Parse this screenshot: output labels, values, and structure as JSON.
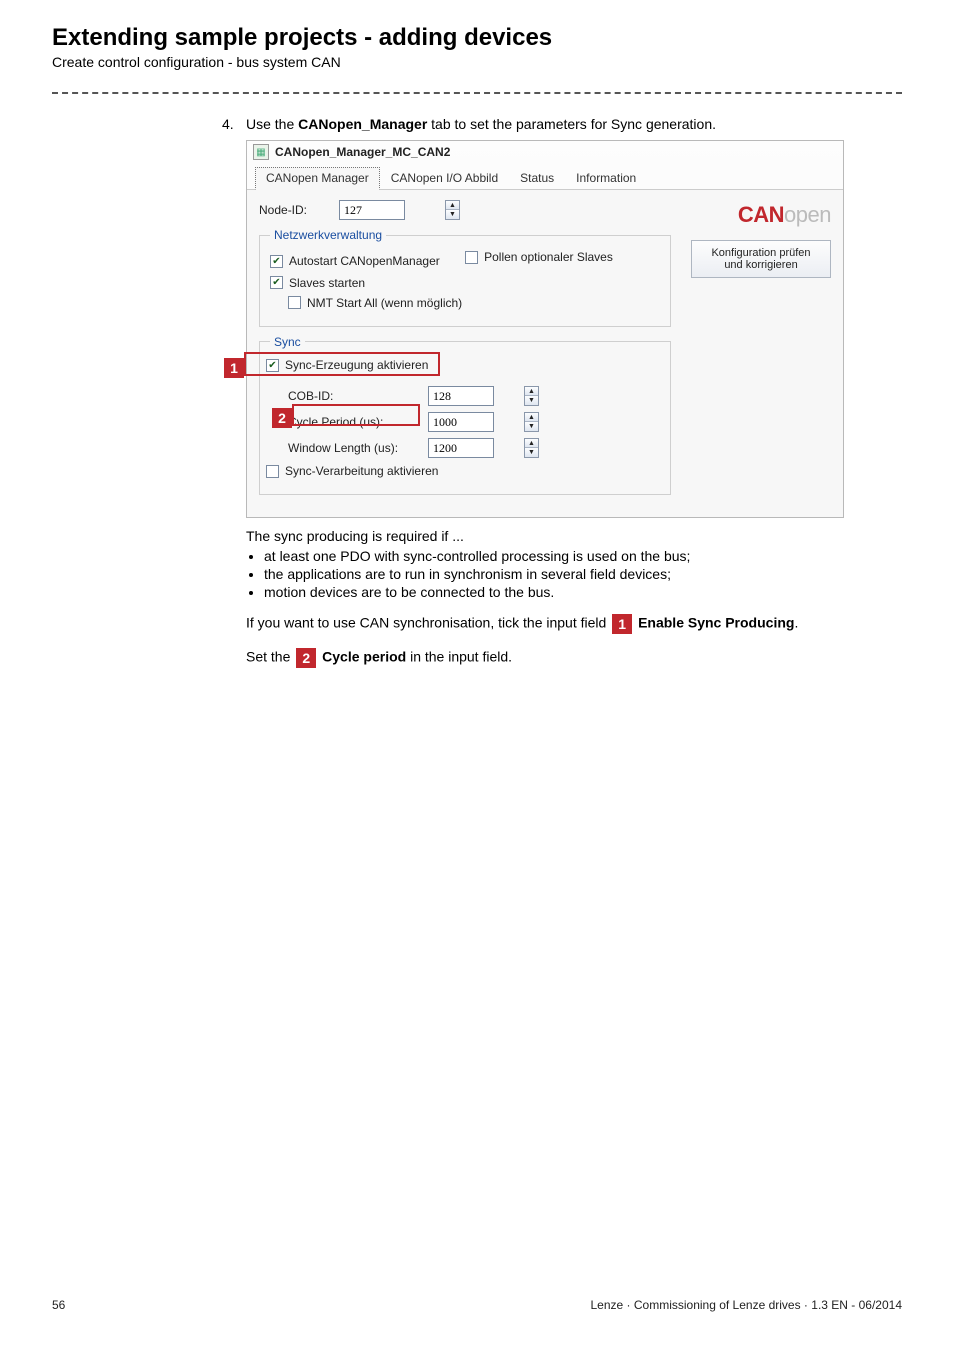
{
  "header": {
    "title": "Extending sample projects - adding devices",
    "subtitle": "Create control configuration - bus system CAN"
  },
  "step": {
    "number": "4.",
    "text_before": "Use the ",
    "bold": "CANopen_Manager",
    "text_after": " tab to set the parameters for Sync generation."
  },
  "shot": {
    "window_title": "CANopen_Manager_MC_CAN2",
    "tabs": [
      "CANopen Manager",
      "CANopen I/O Abbild",
      "Status",
      "Information"
    ],
    "node_id_label": "Node-ID:",
    "node_id_value": "127",
    "net_legend": "Netzwerkverwaltung",
    "autostart": "Autostart CANopenManager",
    "poll_optional": "Pollen optionaler Slaves",
    "slaves_start": "Slaves starten",
    "nmt_start": "NMT Start All (wenn möglich)",
    "sync_legend": "Sync",
    "sync_enable": "Sync-Erzeugung aktivieren",
    "cob_id_label": "COB-ID:",
    "cob_id_value": "128",
    "cycle_label": "Cycle Period (us):",
    "cycle_value": "1000",
    "winlen_label": "Window Length (us):",
    "winlen_value": "1200",
    "sync_proc": "Sync-Verarbeitung aktivieren",
    "logo_bold": "CAN",
    "logo_thin": "open",
    "cfg_btn_l1": "Konfiguration prüfen",
    "cfg_btn_l2": "und korrigieren"
  },
  "callouts": {
    "one": "1",
    "two": "2"
  },
  "body": {
    "intro": "The sync producing is required if ...",
    "bullets": [
      "at least one PDO with sync-controlled processing is used on the bus;",
      "the applications are to run in synchronism in several field devices;",
      "motion devices are to be connected to the bus."
    ],
    "line1_a": "If you want to use CAN synchronisation, tick the input field ",
    "line1_b": " Enable Sync Producing",
    "line1_c": ".",
    "line2_a": "Set the ",
    "line2_b": " Cycle period",
    "line2_c": " in the input field."
  },
  "footer": {
    "page": "56",
    "meta": "Lenze · Commissioning of Lenze drives · 1.3 EN - 06/2014"
  }
}
